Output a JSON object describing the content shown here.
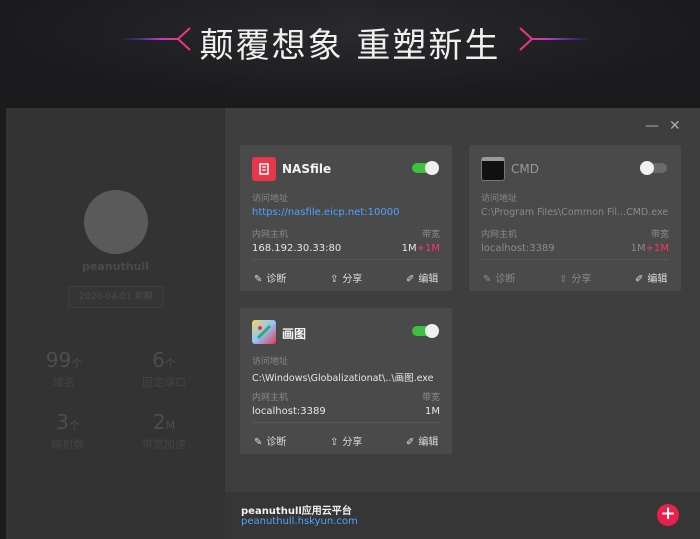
{
  "banner": {
    "title": "颠覆想象 重塑新生"
  },
  "sidebar": {
    "username": "peanuthull",
    "expiry": "2020-04-01 到期",
    "stats": [
      {
        "value": "99",
        "unit": "个",
        "label": "域名"
      },
      {
        "value": "6",
        "unit": "个",
        "label": "固定端口"
      },
      {
        "value": "3",
        "unit": "个",
        "label": "映射数"
      },
      {
        "value": "2",
        "unit": "M",
        "label": "带宽加速"
      }
    ]
  },
  "window": {
    "minimize": "—",
    "close": "✕"
  },
  "cards": [
    {
      "name": "NASfile",
      "enabled": true,
      "addr_label": "访问地址",
      "addr": "https://nasfile.eicp.net:10000",
      "host_label": "内网主机",
      "host": "168.192.30.33:80",
      "bw_label": "带宽",
      "bw": "1M",
      "bw_extra": "+1M",
      "actions": {
        "diagnose": "诊断",
        "share": "分享",
        "edit": "编辑"
      }
    },
    {
      "name": "CMD",
      "enabled": false,
      "addr_label": "访问地址",
      "addr": "C:\\Program Files\\Common Fil...CMD.exe",
      "host_label": "内网主机",
      "host": "localhost:3389",
      "bw_label": "带宽",
      "bw": "1M",
      "bw_extra": "+1M",
      "actions": {
        "diagnose": "诊断",
        "share": "分享",
        "edit": "编辑"
      }
    },
    {
      "name": "画图",
      "enabled": true,
      "addr_label": "访问地址",
      "addr": "C:\\Windows\\Globalizationat\\..\\画图.exe",
      "host_label": "内网主机",
      "host": "localhost:3389",
      "bw_label": "带宽",
      "bw": "1M",
      "bw_extra": "",
      "actions": {
        "diagnose": "诊断",
        "share": "分享",
        "edit": "编辑"
      }
    }
  ],
  "footer": {
    "platform": "peanuthull应用云平台",
    "url": "peanuthull.hskyun.com",
    "add": "+"
  },
  "colors": {
    "accent": "#4ea3ff",
    "toggle_on": "#3fbf3f",
    "add": "#e8204c",
    "bandwidth_extra": "#ff3366"
  }
}
